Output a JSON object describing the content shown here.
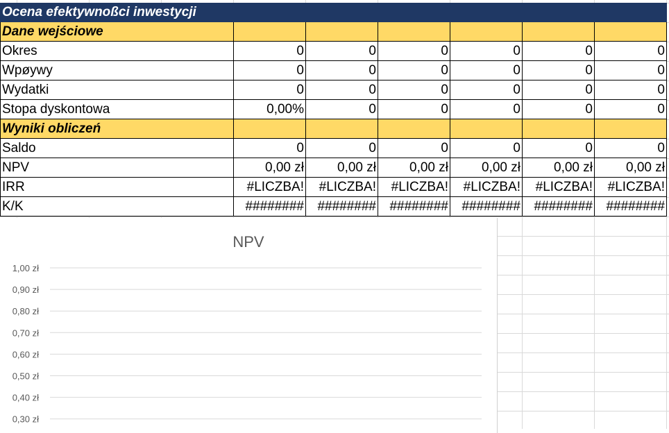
{
  "sheet": {
    "title": "Ocena efektywnoßci inwestycji",
    "section_input": "Dane wejściowe",
    "section_results": "Wyniki obliczeń",
    "rows": {
      "okres": {
        "label": "Okres",
        "values": [
          "0",
          "0",
          "0",
          "0",
          "0",
          "0"
        ]
      },
      "wplywy": {
        "label": "Wpøywy",
        "values": [
          "0",
          "0",
          "0",
          "0",
          "0",
          "0"
        ]
      },
      "wydatki": {
        "label": "Wydatki",
        "values": [
          "0",
          "0",
          "0",
          "0",
          "0",
          "0"
        ]
      },
      "stopa": {
        "label": "Stopa dyskontowa",
        "values": [
          "0,00%",
          "0",
          "0",
          "0",
          "0",
          "0"
        ]
      },
      "saldo": {
        "label": "Saldo",
        "values": [
          "0",
          "0",
          "0",
          "0",
          "0",
          "0"
        ]
      },
      "npv": {
        "label": "NPV",
        "values": [
          "0,00 zł",
          "0,00 zł",
          "0,00 zł",
          "0,00 zł",
          "0,00 zł",
          "0,00 zł"
        ]
      },
      "irr": {
        "label": "IRR",
        "values": [
          "#LICZBA!",
          "#LICZBA!",
          "#LICZBA!",
          "#LICZBA!",
          "#LICZBA!",
          "#LICZBA!"
        ]
      },
      "kk": {
        "label": "K/K",
        "values": [
          "########",
          "########",
          "########",
          "########",
          "########",
          "########"
        ]
      }
    }
  },
  "chart_data": {
    "type": "line",
    "title": "NPV",
    "xlabel": "",
    "ylabel": "",
    "ylim_visible": [
      0.3,
      1.0
    ],
    "y_tick_labels": [
      "1,00 zł",
      "0,90 zł",
      "0,80 zł",
      "0,70 zł",
      "0,60 zł",
      "0,50 zł",
      "0,40 zł",
      "0,30 zł"
    ],
    "y_ticks": [
      1.0,
      0.9,
      0.8,
      0.7,
      0.6,
      0.5,
      0.4,
      0.3
    ],
    "grid": true,
    "series": []
  }
}
